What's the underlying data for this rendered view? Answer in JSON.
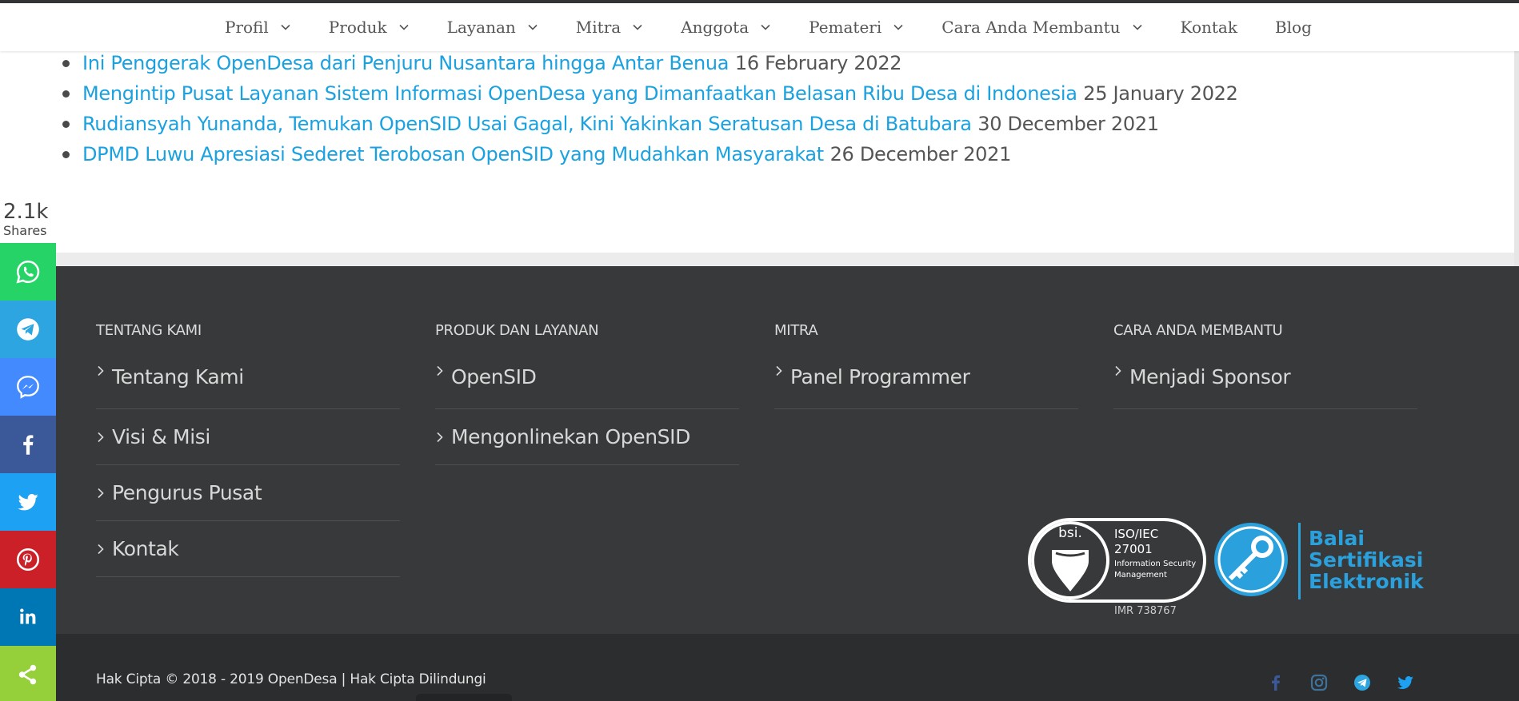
{
  "nav": {
    "items": [
      {
        "label": "Profil",
        "dropdown": true
      },
      {
        "label": "Produk",
        "dropdown": true
      },
      {
        "label": "Layanan",
        "dropdown": true
      },
      {
        "label": "Mitra",
        "dropdown": true
      },
      {
        "label": "Anggota",
        "dropdown": true
      },
      {
        "label": "Pemateri",
        "dropdown": true
      },
      {
        "label": "Cara Anda Membantu",
        "dropdown": true
      },
      {
        "label": "Kontak",
        "dropdown": false
      },
      {
        "label": "Blog",
        "dropdown": false
      }
    ]
  },
  "posts": [
    {
      "title": "Ini Penggerak OpenDesa dari Penjuru Nusantara hingga Antar Benua",
      "date": "16 February 2022"
    },
    {
      "title": "Mengintip Pusat Layanan Sistem Informasi OpenDesa yang Dimanfaatkan Belasan Ribu Desa di Indonesia",
      "date": "25 January 2022"
    },
    {
      "title": "Rudiansyah Yunanda, Temukan OpenSID Usai Gagal, Kini Yakinkan Seratusan Desa di Batubara",
      "date": "30 December 2021"
    },
    {
      "title": "DPMD Luwu Apresiasi Sederet Terobosan OpenSID yang Mudahkan Masyarakat",
      "date": "26 December 2021"
    }
  ],
  "shares": {
    "count": "2.1k",
    "label": "Shares"
  },
  "share_buttons": [
    {
      "icon": "whatsapp-icon",
      "color": "#25d366"
    },
    {
      "icon": "telegram-icon",
      "color": "#2ca5e0"
    },
    {
      "icon": "messenger-icon",
      "color": "#448aff"
    },
    {
      "icon": "facebook-icon",
      "color": "#3b5998"
    },
    {
      "icon": "twitter-icon",
      "color": "#1da1f2"
    },
    {
      "icon": "pinterest-icon",
      "color": "#cb2027"
    },
    {
      "icon": "linkedin-icon",
      "color": "#0077b5"
    },
    {
      "icon": "share-icon",
      "color": "#95d03a"
    }
  ],
  "footer": {
    "columns": [
      {
        "heading": "TENTANG KAMI",
        "links": [
          "Tentang Kami",
          "Visi & Misi",
          "Pengurus Pusat",
          "Kontak"
        ]
      },
      {
        "heading": "PRODUK DAN LAYANAN",
        "links": [
          "OpenSID",
          "Mengonlinekan OpenSID"
        ]
      },
      {
        "heading": "MITRA",
        "links": [
          "Panel Programmer"
        ]
      },
      {
        "heading": "CARA ANDA MEMBANTU",
        "links": [
          "Menjadi Sponsor"
        ]
      }
    ],
    "bsi": {
      "logo": "bsi.",
      "standard": "ISO/IEC",
      "number": "27001",
      "desc1": "Information Security",
      "desc2": "Management",
      "cert": "IMR 738767"
    },
    "bse": {
      "line1": "Balai",
      "line2": "Sertifikasi",
      "line3": "Elektronik"
    },
    "copyright": "Hak Cipta © 2018 - 2019 OpenDesa | Hak Cipta Dilindungi",
    "social": [
      "facebook-icon",
      "instagram-icon",
      "telegram-icon",
      "twitter-icon"
    ]
  },
  "colors": {
    "link": "#1aa1e0",
    "footer": "#38393a",
    "footer_bottom": "#2c2d2e",
    "accent": "#2aa1dd"
  }
}
